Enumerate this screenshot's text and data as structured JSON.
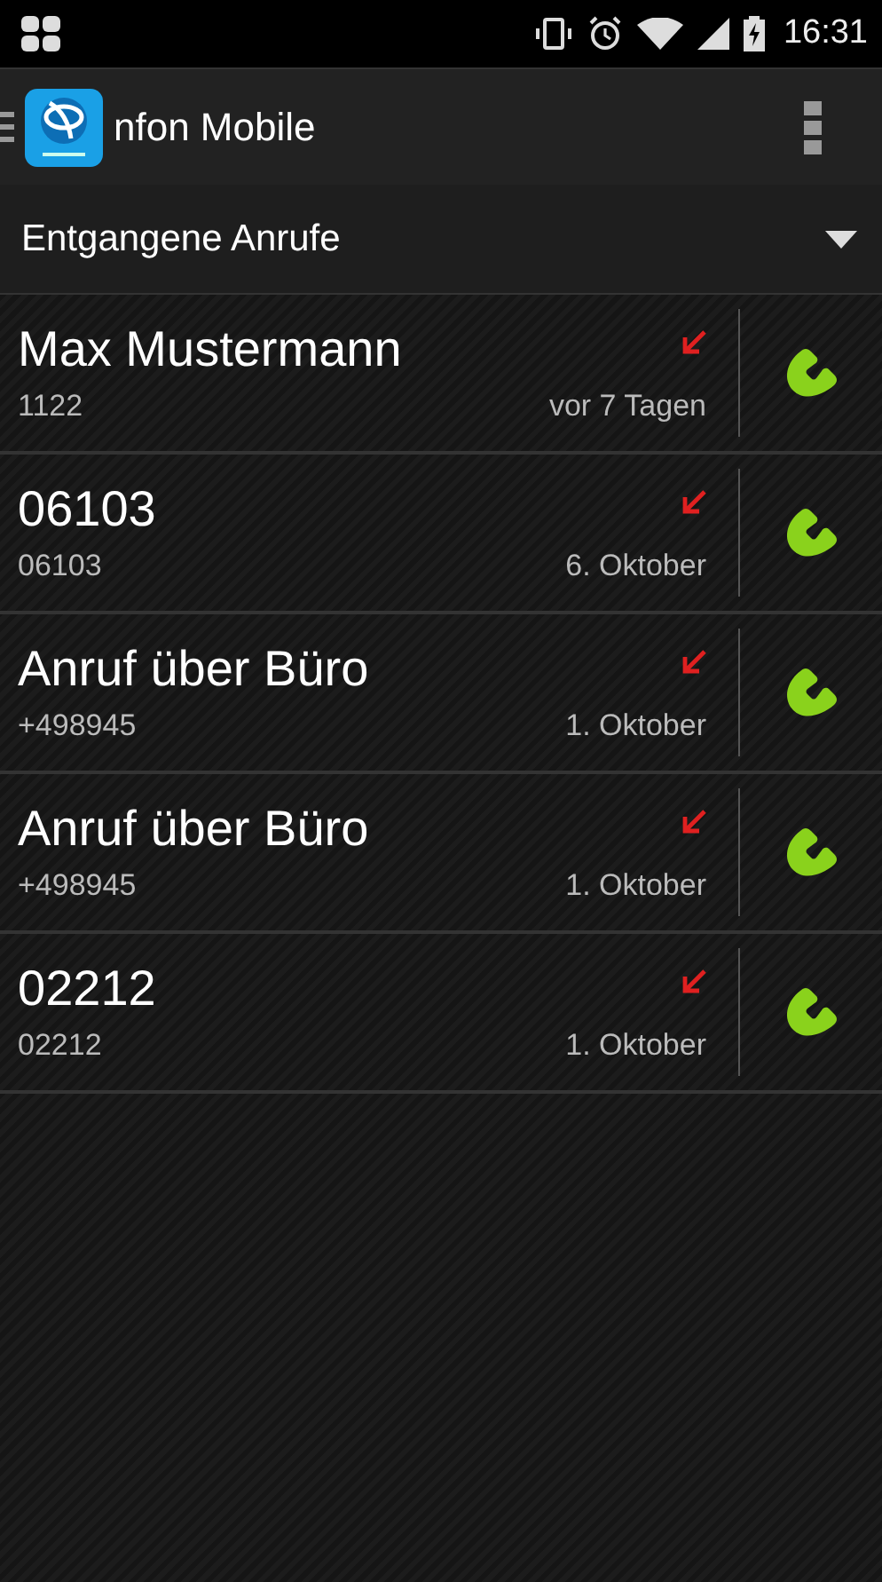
{
  "status_bar": {
    "time": "16:31"
  },
  "app_bar": {
    "title": "nfon Mobile"
  },
  "filter": {
    "label": "Entgangene Anrufe"
  },
  "calls": [
    {
      "name": "Max Mustermann",
      "number": "1122",
      "date": "vor 7 Tagen",
      "kind": "missed"
    },
    {
      "name": "06103",
      "number": "06103",
      "date": "6. Oktober",
      "kind": "missed"
    },
    {
      "name": "Anruf über Büro",
      "number": "+498945",
      "date": "1. Oktober",
      "kind": "missed"
    },
    {
      "name": "Anruf über Büro",
      "number": "+498945",
      "date": "1. Oktober",
      "kind": "missed"
    },
    {
      "name": "02212",
      "number": "02212",
      "date": "1. Oktober",
      "kind": "missed"
    }
  ]
}
